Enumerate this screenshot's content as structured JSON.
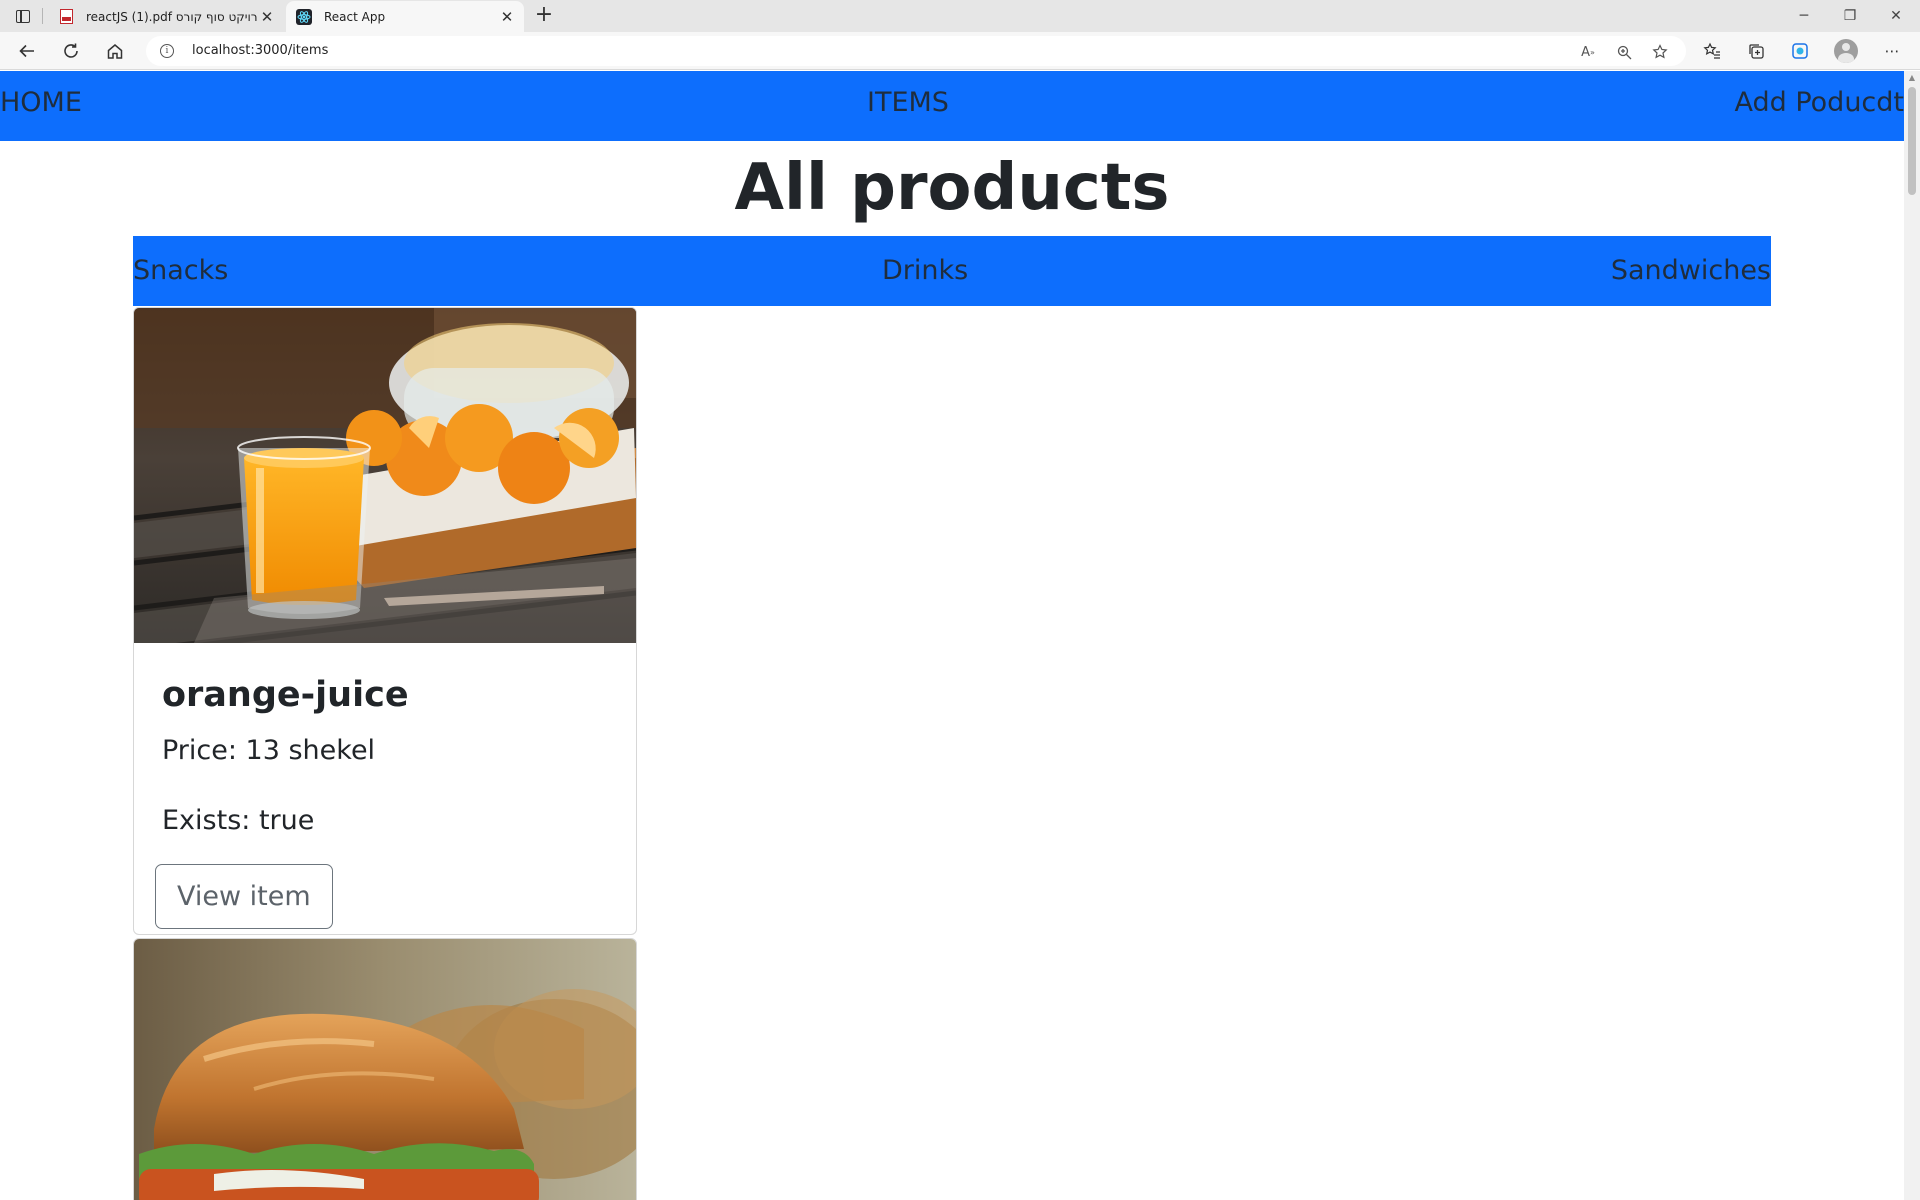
{
  "browser": {
    "tabs": [
      {
        "title": "reactJS (1).pdf פרויקט סוף קורס",
        "active": false,
        "icon": "pdf-icon"
      },
      {
        "title": "React App",
        "active": true,
        "icon": "react-icon"
      }
    ],
    "url": "localhost:3000/items",
    "controls": {
      "minimize": "─",
      "restore": "❐",
      "close": "✕"
    }
  },
  "nav": {
    "home": "HOME",
    "items": "ITEMS",
    "add_product": "Add Poducdt",
    "bg_color": "#0d6efd"
  },
  "page": {
    "title": "All products"
  },
  "categories": {
    "snacks": "Snacks",
    "drinks": "Drinks",
    "sandwiches": "Sandwiches"
  },
  "products": [
    {
      "name": "orange-juice",
      "price": "Price: 13 shekel",
      "exists": "Exists: true",
      "button": "View item",
      "image": "orange juice glass with oranges"
    },
    {
      "name": "",
      "image": "sandwich"
    }
  ]
}
